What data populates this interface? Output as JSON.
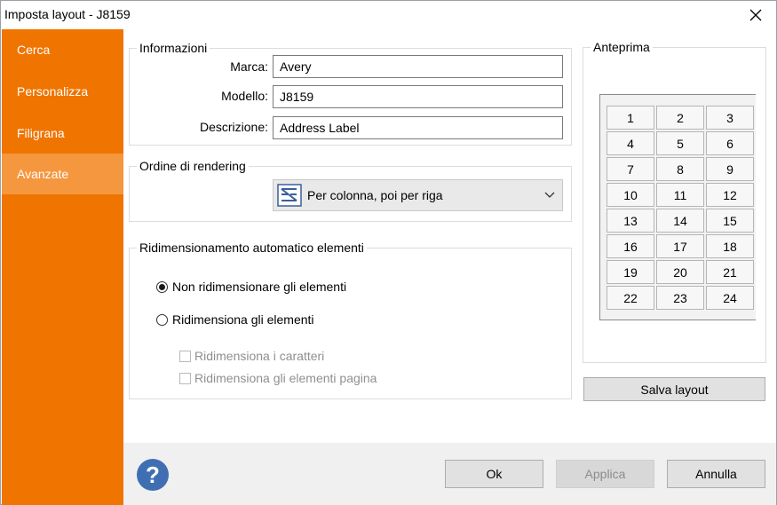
{
  "window": {
    "title": "Imposta layout - J8159"
  },
  "sidebar": {
    "items": [
      {
        "label": "Cerca"
      },
      {
        "label": "Personalizza"
      },
      {
        "label": "Filigrana"
      },
      {
        "label": "Avanzate",
        "active": true
      }
    ]
  },
  "info": {
    "legend": "Informazioni",
    "brand_label": "Marca:",
    "brand_value": "Avery",
    "model_label": "Modello:",
    "model_value": "J8159",
    "desc_label": "Descrizione:",
    "desc_value": "Address Label"
  },
  "render": {
    "legend": "Ordine di rendering",
    "selected": "Per colonna, poi per riga"
  },
  "resize": {
    "legend": "Ridimensionamento automatico elementi",
    "option_none": "Non ridimensionare gli elementi",
    "option_resize": "Ridimensiona gli elementi",
    "check_chars": "Ridimensiona i caratteri",
    "check_page": "Ridimensiona gli elementi pagina",
    "selected": "none"
  },
  "preview": {
    "legend": "Anteprima",
    "cells": [
      "1",
      "2",
      "3",
      "4",
      "5",
      "6",
      "7",
      "8",
      "9",
      "10",
      "11",
      "12",
      "13",
      "14",
      "15",
      "16",
      "17",
      "18",
      "19",
      "20",
      "21",
      "22",
      "23",
      "24"
    ],
    "save_label": "Salva layout"
  },
  "footer": {
    "help_glyph": "?",
    "ok_label": "Ok",
    "apply_label": "Applica",
    "cancel_label": "Annulla"
  },
  "colors": {
    "sidebar": "#f07400",
    "sidebar_active": "#f5973e"
  }
}
